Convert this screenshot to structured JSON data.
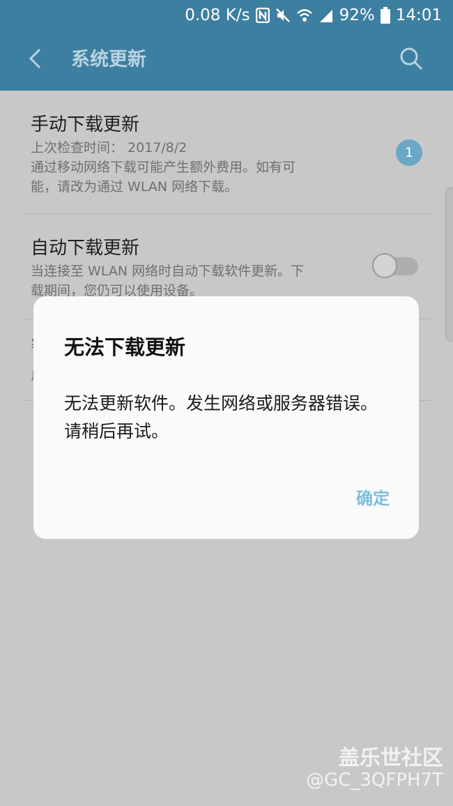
{
  "status_bar": {
    "speed": "0.08 K/s",
    "battery": "92%",
    "time": "14:01",
    "icons": [
      "nfc-icon",
      "mute-icon",
      "wifi-icon",
      "signal-icon",
      "battery-icon"
    ]
  },
  "app_bar": {
    "title": "系统更新",
    "back_icon": "back-arrow-icon",
    "search_icon": "search-icon"
  },
  "settings": {
    "manual": {
      "title": "手动下载更新",
      "last_check": "上次检查时间： 2017/8/2",
      "desc_line1": "通过移动网络下载可能产生额外费用。如有可",
      "desc_line2": "能，请改为通过 WLAN 网络下载。",
      "badge": "1"
    },
    "auto": {
      "title": "自动下载更新",
      "desc_line1": "当连接至 WLAN 网络时自动下载软件更新。下",
      "desc_line2": "载期间，您仍可以使用设备。",
      "toggle_on": false
    },
    "third_partial": {
      "title_char": "¥",
      "sub_char": "ㄏ"
    }
  },
  "dialog": {
    "title": "无法下载更新",
    "message": "无法更新软件。发生网络或服务器错误。请稍后再试。",
    "ok_button": "确定"
  },
  "watermark": {
    "line1": "盖乐世社区",
    "line2": "@GC_3QFPH7T"
  },
  "colors": {
    "header": "#3d7fa0",
    "accent": "#7fbfdc",
    "badge": "#6aa8c6"
  }
}
